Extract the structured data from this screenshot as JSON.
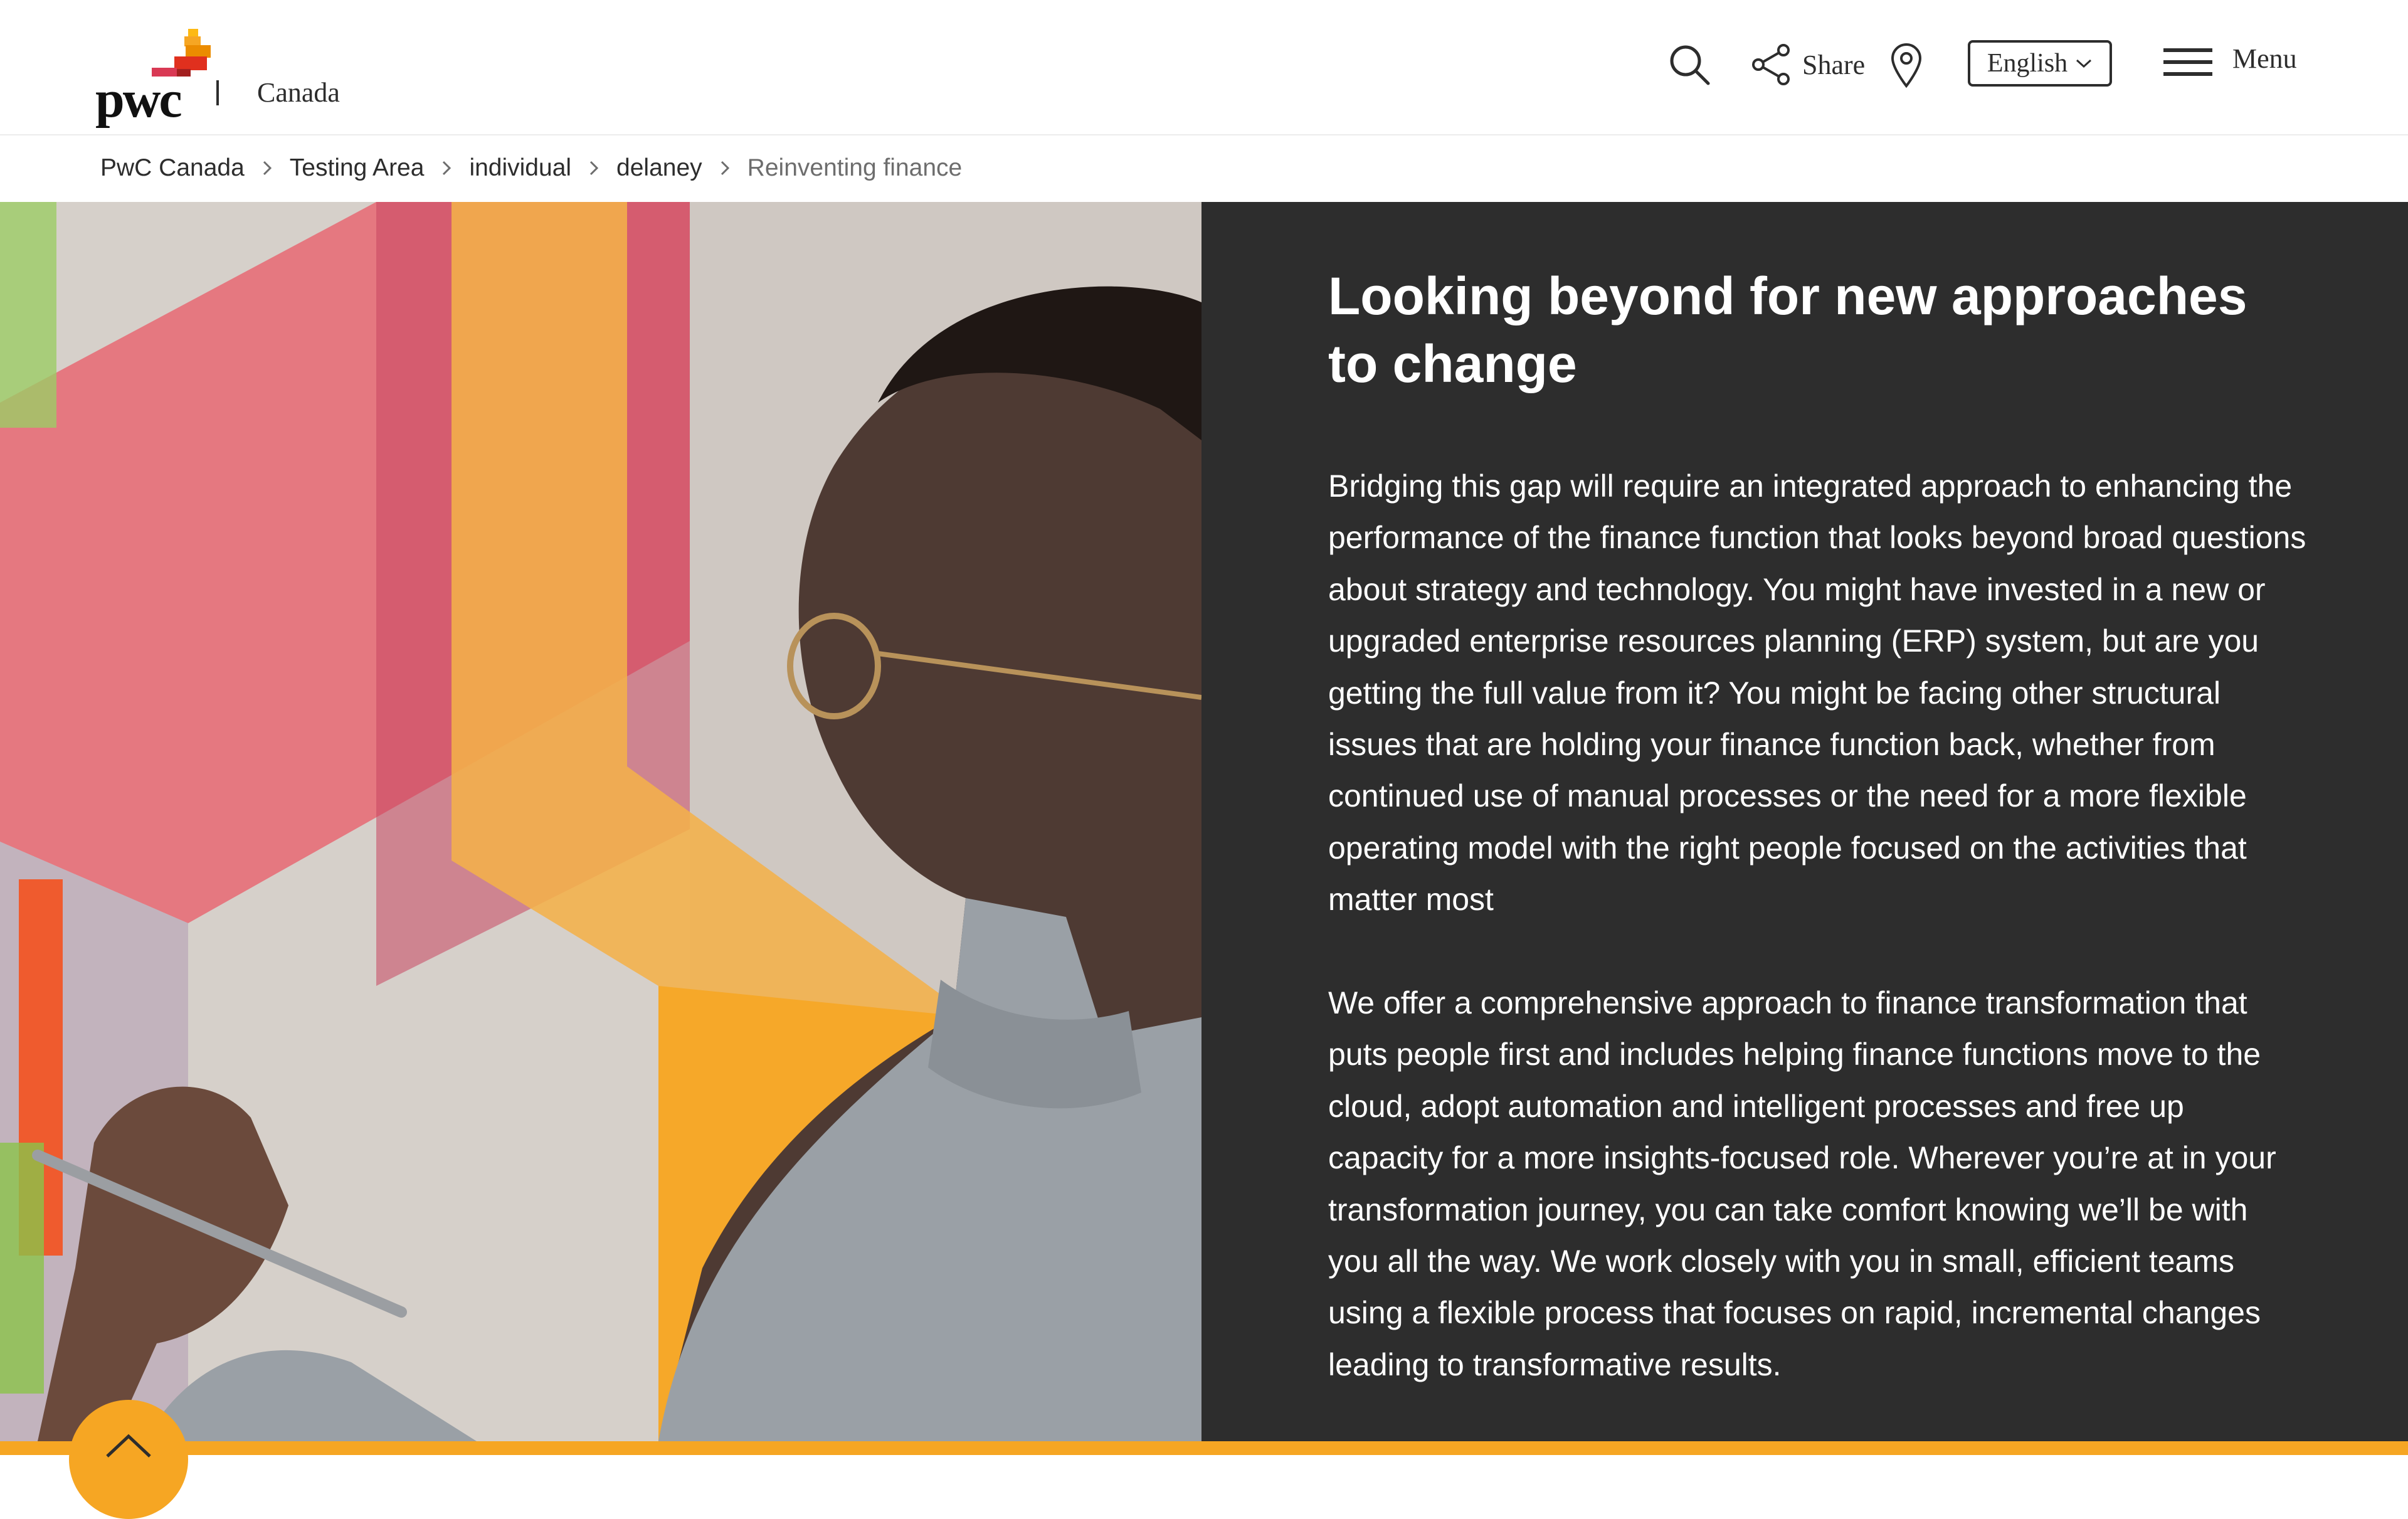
{
  "brand": {
    "logo_text": "pwc",
    "country": "Canada"
  },
  "header": {
    "share_label": "Share",
    "language_label": "English",
    "menu_label": "Menu",
    "icons": [
      "search-icon",
      "share-icon",
      "location-pin-icon",
      "chevron-down-icon",
      "hamburger-icon"
    ]
  },
  "breadcrumb": {
    "items": [
      "PwC Canada",
      "Testing Area",
      "individual",
      "delaney",
      "Reinventing finance"
    ]
  },
  "hero": {
    "title": "Looking beyond for new approaches to change",
    "paragraphs": [
      "Bridging this gap will require an integrated approach to enhancing the performance of the finance function that looks beyond broad questions about strategy and technology. You might have invested in a new or upgraded enterprise resources planning (ERP) system, but are you getting the full value from it? You might be facing other structural issues that are holding your finance function back, whether from continued use of manual processes or the need for a more flexible operating model with the right people focused on the activities that matter most",
      "We offer a comprehensive approach to finance transformation that puts people first and includes helping finance functions move to the cloud, adopt automation and intelligent processes and free up capacity for a more insights-focused role. Wherever you’re at in your transformation journey, you can take comfort knowing we’ll be with you all the way. We work closely with you in small, efficient teams using a flexible process that focuses on rapid, incremental changes leading to transformative results."
    ]
  },
  "colors": {
    "accent_orange": "#f6a623",
    "dark_panel": "#2d2d2d",
    "brand_red": "#e0301e",
    "brand_rose": "#d93954"
  }
}
